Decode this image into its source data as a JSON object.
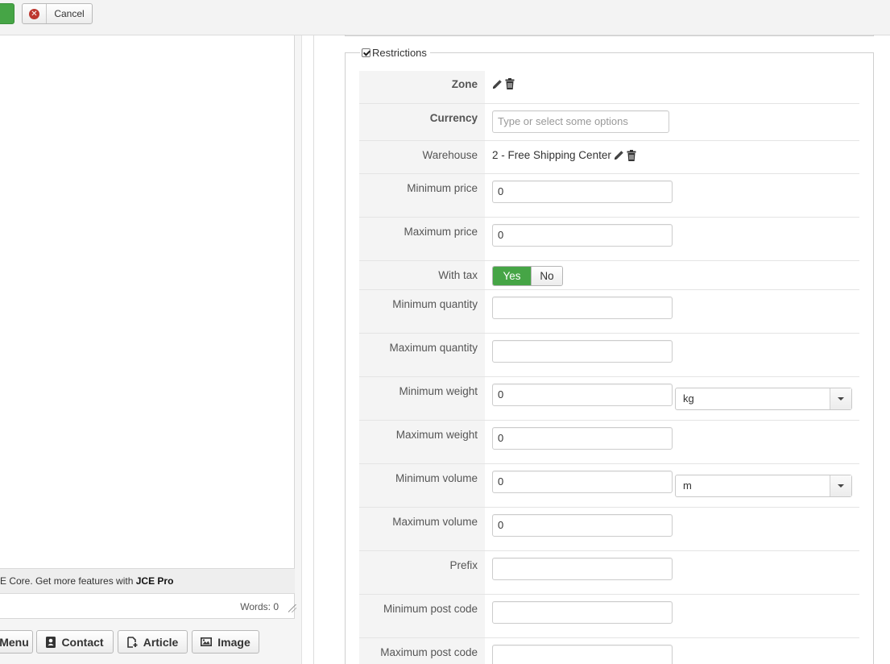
{
  "toolbar": {
    "cancel_label": "Cancel"
  },
  "editor": {
    "notice_prefix": "E Core. Get more features with ",
    "notice_link": "JCE Pro",
    "words_label": "Words: 0"
  },
  "editor_buttons": {
    "menu": "Menu",
    "contact": "Contact",
    "article": "Article",
    "image": "Image"
  },
  "restrictions": {
    "legend": "Restrictions",
    "zone_label": "Zone",
    "currency_label": "Currency",
    "currency_placeholder": "Type or select some options",
    "warehouse_label": "Warehouse",
    "warehouse_value": "2 - Free Shipping Center",
    "min_price_label": "Minimum price",
    "min_price_value": "0",
    "max_price_label": "Maximum price",
    "max_price_value": "0",
    "with_tax_label": "With tax",
    "with_tax_yes": "Yes",
    "with_tax_no": "No",
    "min_qty_label": "Minimum quantity",
    "min_qty_value": "",
    "max_qty_label": "Maximum quantity",
    "max_qty_value": "",
    "min_weight_label": "Minimum weight",
    "min_weight_value": "0",
    "weight_unit": "kg",
    "max_weight_label": "Maximum weight",
    "max_weight_value": "0",
    "min_volume_label": "Minimum volume",
    "min_volume_value": "0",
    "volume_unit": "m",
    "max_volume_label": "Maximum volume",
    "max_volume_value": "0",
    "prefix_label": "Prefix",
    "prefix_value": "",
    "min_postcode_label": "Minimum post code",
    "min_postcode_value": "",
    "max_postcode_label": "Maximum post code",
    "max_postcode_value": ""
  },
  "colors": {
    "accent_green": "#46a546",
    "cancel_red": "#bd362f"
  },
  "icons": {
    "edit": "pencil-icon",
    "delete": "trash-icon",
    "cancel": "cancel-icon"
  }
}
